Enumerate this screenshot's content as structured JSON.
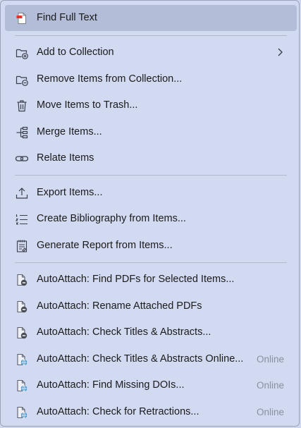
{
  "menu": {
    "items": [
      {
        "label": "Find Full Text",
        "icon": "pdf-file-icon"
      },
      {
        "label": "Add to Collection",
        "icon": "folder-add-icon",
        "submenu": true
      },
      {
        "label": "Remove Items from Collection...",
        "icon": "folder-remove-icon"
      },
      {
        "label": "Move Items to Trash...",
        "icon": "trash-icon"
      },
      {
        "label": "Merge Items...",
        "icon": "merge-icon"
      },
      {
        "label": "Relate Items",
        "icon": "link-icon"
      },
      {
        "label": "Export Items...",
        "icon": "export-icon"
      },
      {
        "label": "Create Bibliography from Items...",
        "icon": "numbered-list-icon"
      },
      {
        "label": "Generate Report from Items...",
        "icon": "report-icon"
      },
      {
        "label": "AutoAttach: Find PDFs for Selected Items...",
        "icon": "doc-minus-icon"
      },
      {
        "label": "AutoAttach: Rename Attached PDFs",
        "icon": "doc-minus-icon"
      },
      {
        "label": "AutoAttach: Check Titles & Abstracts...",
        "icon": "doc-minus-icon"
      },
      {
        "label": "AutoAttach: Check Titles & Abstracts Online...",
        "icon": "doc-globe-icon",
        "hint": "Online"
      },
      {
        "label": "AutoAttach: Find Missing DOIs...",
        "icon": "doc-globe-icon",
        "hint": "Online"
      },
      {
        "label": "AutoAttach: Check for Retractions...",
        "icon": "doc-globe-icon",
        "hint": "Online"
      }
    ]
  }
}
